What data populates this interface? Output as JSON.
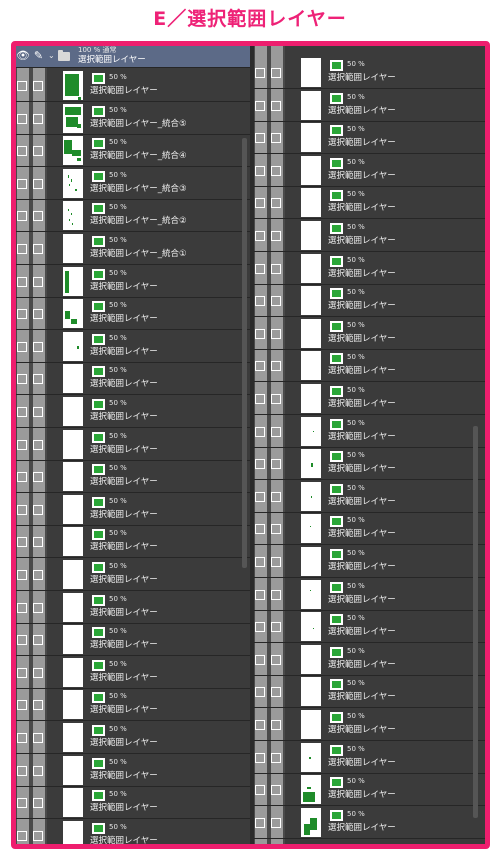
{
  "title": "E／選択範囲レイヤー",
  "colors": {
    "accent": "#ee1e6e",
    "layer_color": "#2aa637"
  },
  "folder": {
    "opacity": "100 % 通常",
    "name": "選択範囲レイヤー",
    "expanded": true
  },
  "left_layers": [
    {
      "opacity": "50 %",
      "name": "選択範囲レイヤー"
    },
    {
      "opacity": "50 %",
      "name": "選択範囲レイヤー_統合⑤"
    },
    {
      "opacity": "50 %",
      "name": "選択範囲レイヤー_統合④"
    },
    {
      "opacity": "50 %",
      "name": "選択範囲レイヤー_統合③"
    },
    {
      "opacity": "50 %",
      "name": "選択範囲レイヤー_統合②"
    },
    {
      "opacity": "50 %",
      "name": "選択範囲レイヤー_統合①"
    },
    {
      "opacity": "50 %",
      "name": "選択範囲レイヤー"
    },
    {
      "opacity": "50 %",
      "name": "選択範囲レイヤー"
    },
    {
      "opacity": "50 %",
      "name": "選択範囲レイヤー"
    },
    {
      "opacity": "50 %",
      "name": "選択範囲レイヤー"
    },
    {
      "opacity": "50 %",
      "name": "選択範囲レイヤー"
    },
    {
      "opacity": "50 %",
      "name": "選択範囲レイヤー"
    },
    {
      "opacity": "50 %",
      "name": "選択範囲レイヤー"
    },
    {
      "opacity": "50 %",
      "name": "選択範囲レイヤー"
    },
    {
      "opacity": "50 %",
      "name": "選択範囲レイヤー"
    },
    {
      "opacity": "50 %",
      "name": "選択範囲レイヤー"
    },
    {
      "opacity": "50 %",
      "name": "選択範囲レイヤー"
    },
    {
      "opacity": "50 %",
      "name": "選択範囲レイヤー"
    },
    {
      "opacity": "50 %",
      "name": "選択範囲レイヤー"
    },
    {
      "opacity": "50 %",
      "name": "選択範囲レイヤー"
    },
    {
      "opacity": "50 %",
      "name": "選択範囲レイヤー"
    },
    {
      "opacity": "50 %",
      "name": "選択範囲レイヤー"
    },
    {
      "opacity": "50 %",
      "name": "選択範囲レイヤー"
    },
    {
      "opacity": "50 %",
      "name": "選択範囲レイヤー"
    },
    {
      "opacity": "50 %",
      "name": ""
    }
  ],
  "right_layers": [
    {
      "opacity": "50 %",
      "name": "選択範囲レイヤー"
    },
    {
      "opacity": "50 %",
      "name": "選択範囲レイヤー"
    },
    {
      "opacity": "50 %",
      "name": "選択範囲レイヤー"
    },
    {
      "opacity": "50 %",
      "name": "選択範囲レイヤー"
    },
    {
      "opacity": "50 %",
      "name": "選択範囲レイヤー"
    },
    {
      "opacity": "50 %",
      "name": "選択範囲レイヤー"
    },
    {
      "opacity": "50 %",
      "name": "選択範囲レイヤー"
    },
    {
      "opacity": "50 %",
      "name": "選択範囲レイヤー"
    },
    {
      "opacity": "50 %",
      "name": "選択範囲レイヤー"
    },
    {
      "opacity": "50 %",
      "name": "選択範囲レイヤー"
    },
    {
      "opacity": "50 %",
      "name": "選択範囲レイヤー"
    },
    {
      "opacity": "50 %",
      "name": "選択範囲レイヤー"
    },
    {
      "opacity": "50 %",
      "name": "選択範囲レイヤー"
    },
    {
      "opacity": "50 %",
      "name": "選択範囲レイヤー"
    },
    {
      "opacity": "50 %",
      "name": "選択範囲レイヤー"
    },
    {
      "opacity": "50 %",
      "name": "選択範囲レイヤー"
    },
    {
      "opacity": "50 %",
      "name": "選択範囲レイヤー"
    },
    {
      "opacity": "50 %",
      "name": "選択範囲レイヤー"
    },
    {
      "opacity": "50 %",
      "name": "選択範囲レイヤー"
    },
    {
      "opacity": "50 %",
      "name": "選択範囲レイヤー"
    },
    {
      "opacity": "50 %",
      "name": "選択範囲レイヤー"
    },
    {
      "opacity": "50 %",
      "name": "選択範囲レイヤー"
    },
    {
      "opacity": "50 %",
      "name": "選択範囲レイヤー"
    },
    {
      "opacity": "50 %",
      "name": "選択範囲レイヤー"
    }
  ]
}
